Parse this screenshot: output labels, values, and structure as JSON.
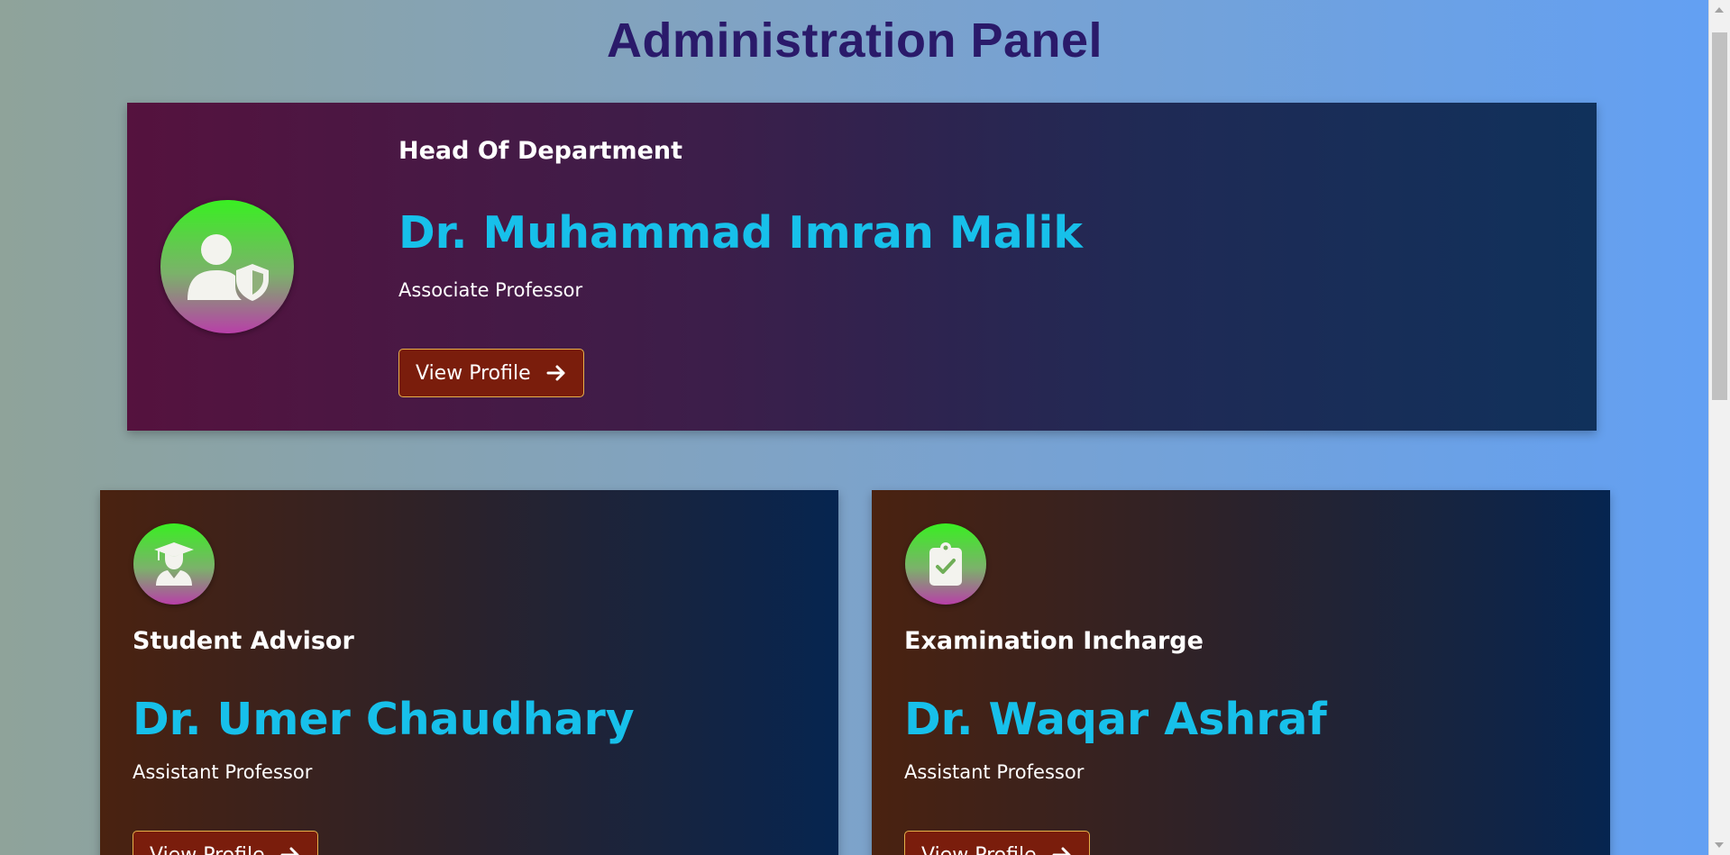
{
  "page": {
    "title": "Administration Panel"
  },
  "colors": {
    "title": "#2a1a6a",
    "name": "#17c0ea",
    "button_bg": "#7a1d0c",
    "button_border": "#e6b04a"
  },
  "cards": [
    {
      "role": "Head Of Department",
      "name": "Dr. Muhammad Imran Malik",
      "title": "Associate Professor",
      "button_label": "View Profile",
      "icon": "user-shield-icon"
    },
    {
      "role": "Student Advisor",
      "name": "Dr. Umer Chaudhary",
      "title": "Assistant Professor",
      "button_label": "View Profile",
      "icon": "graduate-icon"
    },
    {
      "role": "Examination Incharge",
      "name": "Dr. Waqar Ashraf",
      "title": "Assistant Professor",
      "button_label": "View Profile",
      "icon": "clipboard-check-icon"
    }
  ]
}
